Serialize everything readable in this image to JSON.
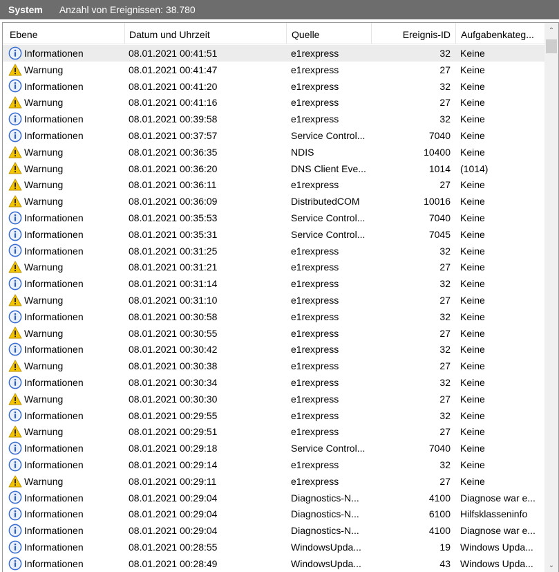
{
  "topbar": {
    "title": "System",
    "count_label": "Anzahl von Ereignissen: 38.780"
  },
  "columns": {
    "level": "Ebene",
    "date": "Datum und Uhrzeit",
    "source": "Quelle",
    "id": "Ereignis-ID",
    "category": "Aufgabenkateg..."
  },
  "icons": {
    "info": "info-icon",
    "warning": "warning-icon",
    "info_color": "#3a6ed0",
    "warning_color": "#f5c400"
  },
  "rows": [
    {
      "type": "info",
      "level": "Informationen",
      "date": "08.01.2021 00:41:51",
      "source": "e1rexpress",
      "id": "32",
      "category": "Keine"
    },
    {
      "type": "warning",
      "level": "Warnung",
      "date": "08.01.2021 00:41:47",
      "source": "e1rexpress",
      "id": "27",
      "category": "Keine"
    },
    {
      "type": "info",
      "level": "Informationen",
      "date": "08.01.2021 00:41:20",
      "source": "e1rexpress",
      "id": "32",
      "category": "Keine"
    },
    {
      "type": "warning",
      "level": "Warnung",
      "date": "08.01.2021 00:41:16",
      "source": "e1rexpress",
      "id": "27",
      "category": "Keine"
    },
    {
      "type": "info",
      "level": "Informationen",
      "date": "08.01.2021 00:39:58",
      "source": "e1rexpress",
      "id": "32",
      "category": "Keine"
    },
    {
      "type": "info",
      "level": "Informationen",
      "date": "08.01.2021 00:37:57",
      "source": "Service Control...",
      "id": "7040",
      "category": "Keine"
    },
    {
      "type": "warning",
      "level": "Warnung",
      "date": "08.01.2021 00:36:35",
      "source": "NDIS",
      "id": "10400",
      "category": "Keine"
    },
    {
      "type": "warning",
      "level": "Warnung",
      "date": "08.01.2021 00:36:20",
      "source": "DNS Client Eve...",
      "id": "1014",
      "category": "(1014)"
    },
    {
      "type": "warning",
      "level": "Warnung",
      "date": "08.01.2021 00:36:11",
      "source": "e1rexpress",
      "id": "27",
      "category": "Keine"
    },
    {
      "type": "warning",
      "level": "Warnung",
      "date": "08.01.2021 00:36:09",
      "source": "DistributedCOM",
      "id": "10016",
      "category": "Keine"
    },
    {
      "type": "info",
      "level": "Informationen",
      "date": "08.01.2021 00:35:53",
      "source": "Service Control...",
      "id": "7040",
      "category": "Keine"
    },
    {
      "type": "info",
      "level": "Informationen",
      "date": "08.01.2021 00:35:31",
      "source": "Service Control...",
      "id": "7045",
      "category": "Keine"
    },
    {
      "type": "info",
      "level": "Informationen",
      "date": "08.01.2021 00:31:25",
      "source": "e1rexpress",
      "id": "32",
      "category": "Keine"
    },
    {
      "type": "warning",
      "level": "Warnung",
      "date": "08.01.2021 00:31:21",
      "source": "e1rexpress",
      "id": "27",
      "category": "Keine"
    },
    {
      "type": "info",
      "level": "Informationen",
      "date": "08.01.2021 00:31:14",
      "source": "e1rexpress",
      "id": "32",
      "category": "Keine"
    },
    {
      "type": "warning",
      "level": "Warnung",
      "date": "08.01.2021 00:31:10",
      "source": "e1rexpress",
      "id": "27",
      "category": "Keine"
    },
    {
      "type": "info",
      "level": "Informationen",
      "date": "08.01.2021 00:30:58",
      "source": "e1rexpress",
      "id": "32",
      "category": "Keine"
    },
    {
      "type": "warning",
      "level": "Warnung",
      "date": "08.01.2021 00:30:55",
      "source": "e1rexpress",
      "id": "27",
      "category": "Keine"
    },
    {
      "type": "info",
      "level": "Informationen",
      "date": "08.01.2021 00:30:42",
      "source": "e1rexpress",
      "id": "32",
      "category": "Keine"
    },
    {
      "type": "warning",
      "level": "Warnung",
      "date": "08.01.2021 00:30:38",
      "source": "e1rexpress",
      "id": "27",
      "category": "Keine"
    },
    {
      "type": "info",
      "level": "Informationen",
      "date": "08.01.2021 00:30:34",
      "source": "e1rexpress",
      "id": "32",
      "category": "Keine"
    },
    {
      "type": "warning",
      "level": "Warnung",
      "date": "08.01.2021 00:30:30",
      "source": "e1rexpress",
      "id": "27",
      "category": "Keine"
    },
    {
      "type": "info",
      "level": "Informationen",
      "date": "08.01.2021 00:29:55",
      "source": "e1rexpress",
      "id": "32",
      "category": "Keine"
    },
    {
      "type": "warning",
      "level": "Warnung",
      "date": "08.01.2021 00:29:51",
      "source": "e1rexpress",
      "id": "27",
      "category": "Keine"
    },
    {
      "type": "info",
      "level": "Informationen",
      "date": "08.01.2021 00:29:18",
      "source": "Service Control...",
      "id": "7040",
      "category": "Keine"
    },
    {
      "type": "info",
      "level": "Informationen",
      "date": "08.01.2021 00:29:14",
      "source": "e1rexpress",
      "id": "32",
      "category": "Keine"
    },
    {
      "type": "warning",
      "level": "Warnung",
      "date": "08.01.2021 00:29:11",
      "source": "e1rexpress",
      "id": "27",
      "category": "Keine"
    },
    {
      "type": "info",
      "level": "Informationen",
      "date": "08.01.2021 00:29:04",
      "source": "Diagnostics-N...",
      "id": "4100",
      "category": "Diagnose war e..."
    },
    {
      "type": "info",
      "level": "Informationen",
      "date": "08.01.2021 00:29:04",
      "source": "Diagnostics-N...",
      "id": "6100",
      "category": "Hilfsklasseninfo"
    },
    {
      "type": "info",
      "level": "Informationen",
      "date": "08.01.2021 00:29:04",
      "source": "Diagnostics-N...",
      "id": "4100",
      "category": "Diagnose war e..."
    },
    {
      "type": "info",
      "level": "Informationen",
      "date": "08.01.2021 00:28:55",
      "source": "WindowsUpda...",
      "id": "19",
      "category": "Windows Upda..."
    },
    {
      "type": "info",
      "level": "Informationen",
      "date": "08.01.2021 00:28:49",
      "source": "WindowsUpda...",
      "id": "43",
      "category": "Windows Upda..."
    }
  ]
}
